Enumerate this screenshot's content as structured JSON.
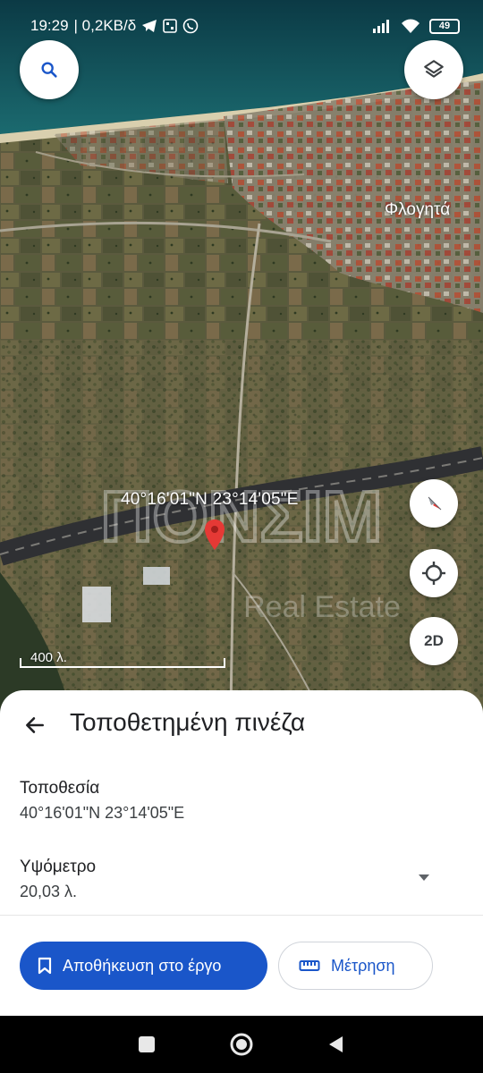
{
  "status_bar": {
    "time": "19:29",
    "speed": "| 0,2KB/δ",
    "battery": "49"
  },
  "map": {
    "town_label": "Φλογητά",
    "coordinates_label": "40°16'01\"N 23°14'05\"E",
    "scale_label": "400 λ.",
    "twod_label": "2D",
    "watermark_text": "ΠΟΝΣΙΜ",
    "watermark_sub": "Real Estate"
  },
  "sheet": {
    "title": "Τοποθετημένη πινέζα",
    "location_label": "Τοποθεσία",
    "location_value": "40°16'01\"N 23°14'05\"E",
    "elevation_label": "Υψόμετρο",
    "elevation_value": "20,03 λ.",
    "save_button": "Αποθήκευση στο έργο",
    "measure_button": "Μέτρηση"
  },
  "colors": {
    "accent": "#1a56c9",
    "pin": "#e53935",
    "sea": "#0e4a55"
  },
  "icons": [
    "search-icon",
    "layers-icon",
    "compass-icon",
    "my-location-icon",
    "back-arrow-icon",
    "bookmark-icon",
    "ruler-icon",
    "dropdown-arrow-icon",
    "nav-recents-icon",
    "nav-home-icon",
    "nav-back-icon"
  ]
}
